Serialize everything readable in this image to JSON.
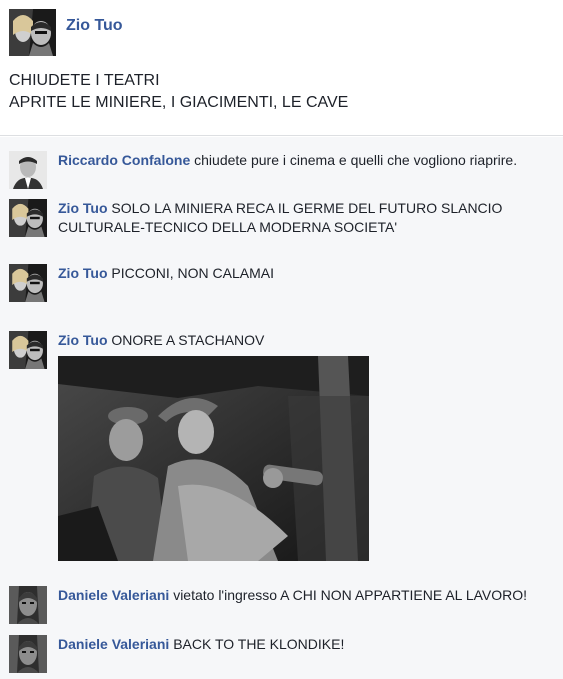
{
  "post": {
    "author": "Zio Tuo",
    "lines": [
      "CHIUDETE I TEATRI",
      "APRITE LE MINIERE, I GIACIMENTI, LE CAVE"
    ]
  },
  "comments": [
    {
      "author": "Riccardo Confalone",
      "text": "chiudete pure i cinema e quelli che vogliono riaprire."
    },
    {
      "author": "Zio Tuo",
      "text": "SOLO LA MINIERA RECA IL GERME DEL FUTURO SLANCIO CULTURALE-TECNICO DELLA MODERNA SOCIETA'"
    },
    {
      "author": "Zio Tuo",
      "text": "PICCONI, NON CALAMAI"
    },
    {
      "author": "Zio Tuo",
      "text": "ONORE A STACHANOV"
    },
    {
      "author": "Daniele Valeriani",
      "text": "vietato l'ingresso A CHI NON APPARTIENE AL LAVORO!"
    },
    {
      "author": "Daniele Valeriani",
      "text": "BACK TO THE KLONDIKE!"
    }
  ],
  "colors": {
    "link": "#365899",
    "text": "#1d2129",
    "comments_bg": "#f6f7f9",
    "divider": "#dddfe2"
  }
}
